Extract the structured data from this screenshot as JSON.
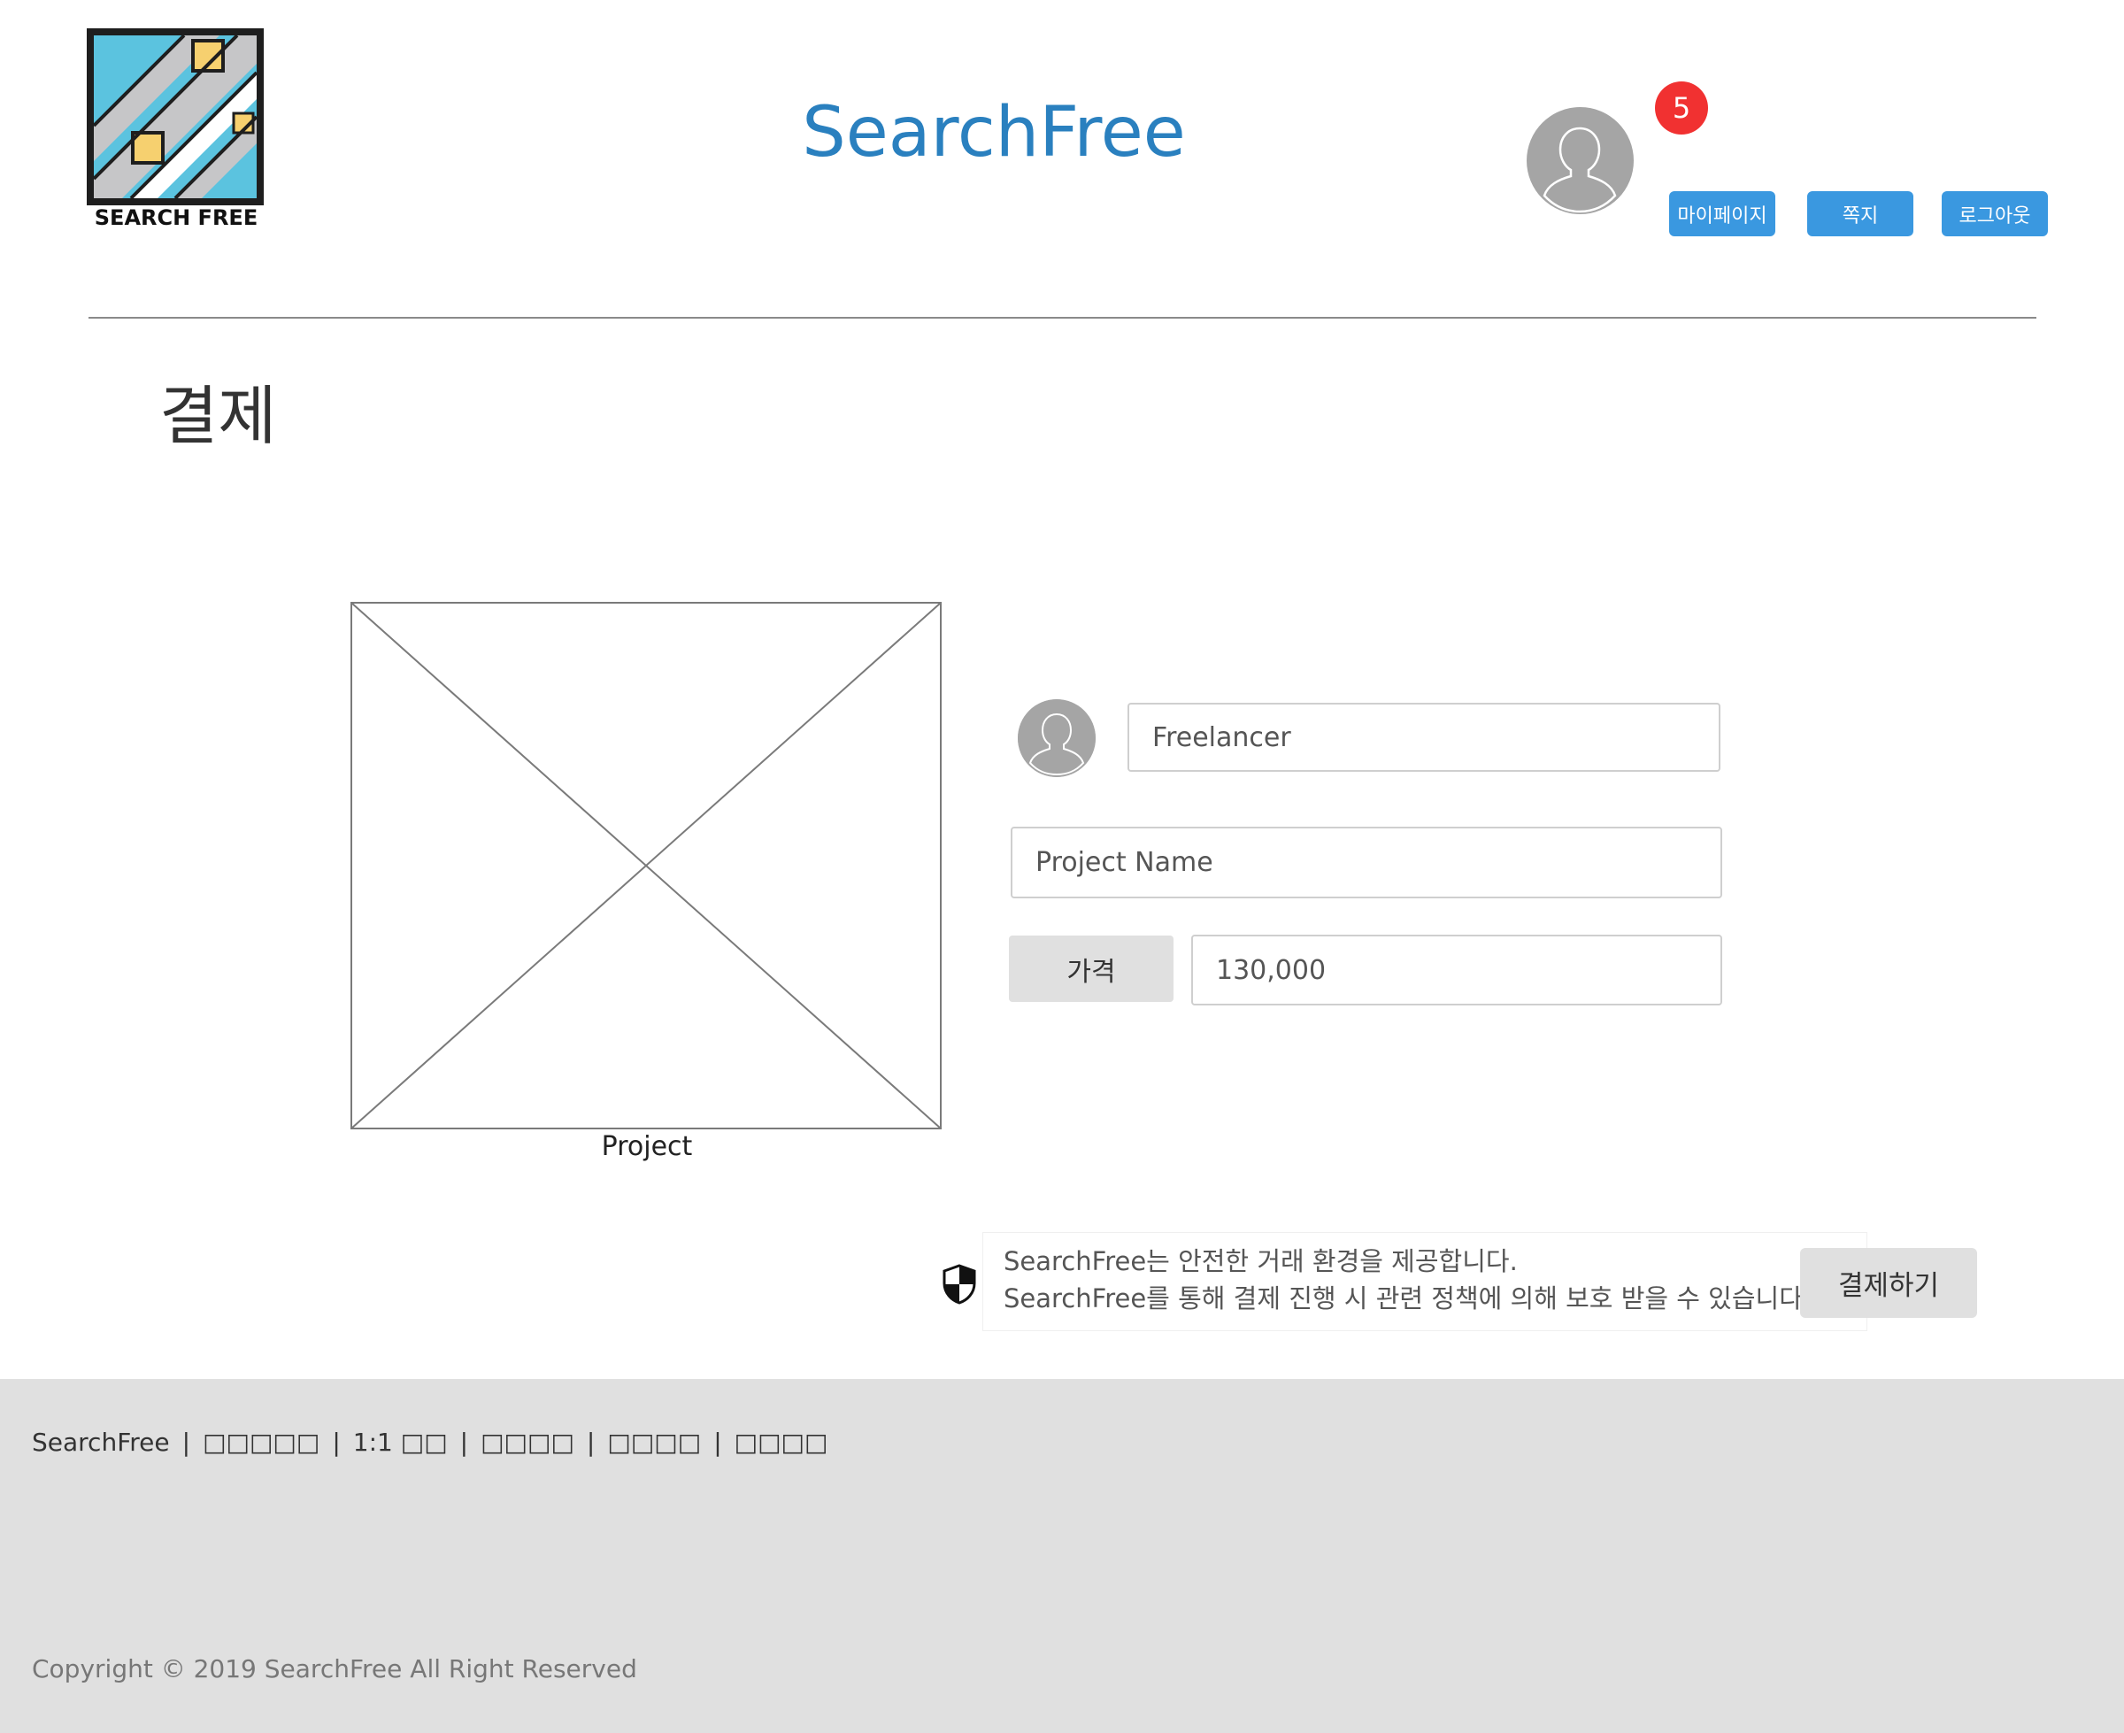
{
  "header": {
    "logo_text": "SEARCH FREE",
    "site_title": "SearchFree",
    "notification_count": "5",
    "buttons": {
      "mypage": "마이페이지",
      "message": "쪽지",
      "logout": "로그아웃"
    }
  },
  "page": {
    "heading": "결제"
  },
  "project": {
    "caption": "Project"
  },
  "form": {
    "freelancer_value": "Freelancer",
    "project_name_value": "Project Name",
    "price_label": "가격",
    "price_value": "130,000"
  },
  "notice": {
    "line1": "SearchFree는 안전한 거래 환경을 제공합니다.",
    "line2": "SearchFree를 통해 결제 진행 시 관련 정책에 의해 보호 받을 수 있습니다.",
    "pay_button": "결제하기"
  },
  "footer": {
    "brand": "SearchFree",
    "links": [
      "□□□□□",
      "1:1 □□",
      "□□□□",
      "□□□□",
      "□□□□"
    ],
    "copyright": "Copyright © 2019 SearchFree All Right Reserved"
  },
  "colors": {
    "title_blue": "#2a80bf",
    "button_blue": "#3a98e0",
    "badge_red": "#f13131",
    "footer_bg": "#e0e0e0"
  }
}
